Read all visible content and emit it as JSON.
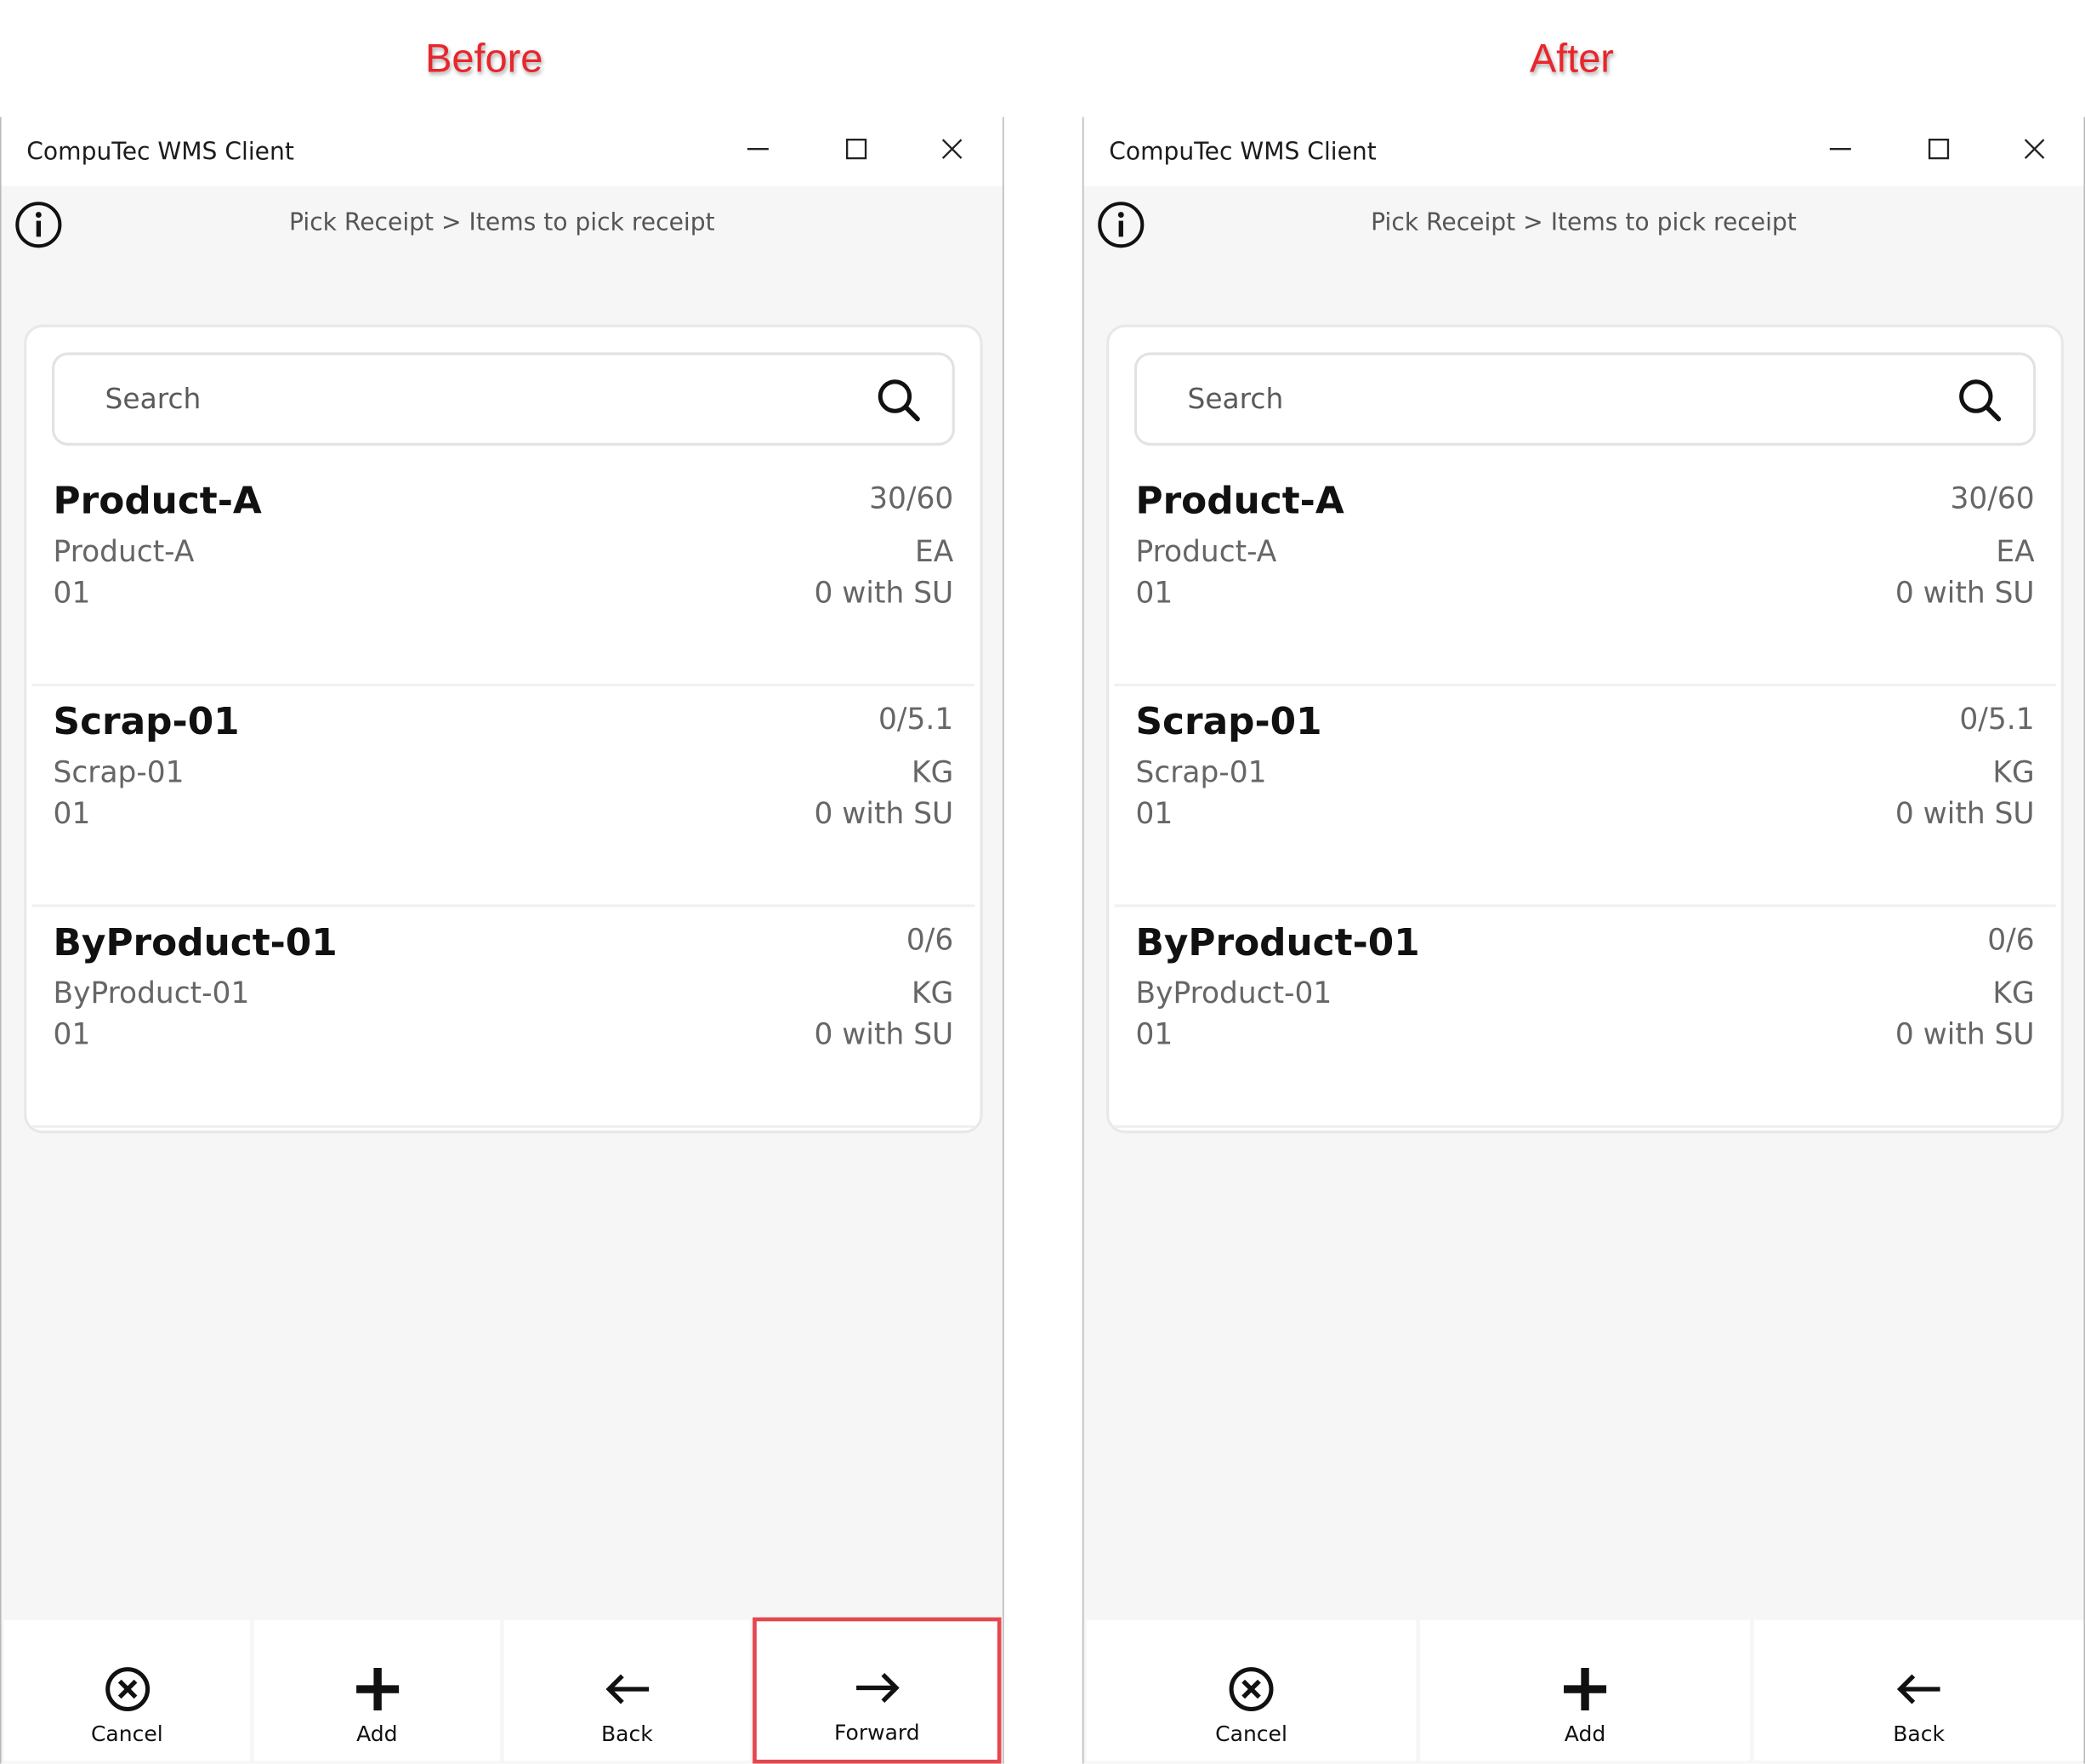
{
  "captions": {
    "before": "Before",
    "after": "After"
  },
  "before": {
    "window_title": "CompuTec WMS Client",
    "breadcrumb": "Pick Receipt > Items to pick receipt",
    "search_placeholder": "Search",
    "items": [
      {
        "name": "Product-A",
        "code": "Product-A",
        "warehouse": "01",
        "qty": "30/60",
        "uom": "EA",
        "su": "0 with SU"
      },
      {
        "name": "Scrap-01",
        "code": "Scrap-01",
        "warehouse": "01",
        "qty": "0/5.1",
        "uom": "KG",
        "su": "0 with SU"
      },
      {
        "name": "ByProduct-01",
        "code": "ByProduct-01",
        "warehouse": "01",
        "qty": "0/6",
        "uom": "KG",
        "su": "0 with SU"
      }
    ],
    "toolbar": {
      "cancel": "Cancel",
      "add": "Add",
      "back": "Back",
      "forward": "Forward"
    }
  },
  "after": {
    "window_title": "CompuTec WMS Client",
    "breadcrumb": "Pick Receipt > Items to pick receipt",
    "search_placeholder": "Search",
    "items": [
      {
        "name": "Product-A",
        "code": "Product-A",
        "warehouse": "01",
        "qty": "30/60",
        "uom": "EA",
        "su": "0 with SU"
      },
      {
        "name": "Scrap-01",
        "code": "Scrap-01",
        "warehouse": "01",
        "qty": "0/5.1",
        "uom": "KG",
        "su": "0 with SU"
      },
      {
        "name": "ByProduct-01",
        "code": "ByProduct-01",
        "warehouse": "01",
        "qty": "0/6",
        "uom": "KG",
        "su": "0 with SU"
      }
    ],
    "toolbar": {
      "cancel": "Cancel",
      "add": "Add",
      "back": "Back"
    }
  },
  "colors": {
    "caption": "#e8262c",
    "highlight": "#e5474f",
    "background": "#f5f6f5"
  },
  "icons": [
    "info-icon",
    "search-icon",
    "minimize-icon",
    "maximize-icon",
    "close-icon",
    "cancel-icon",
    "add-icon",
    "back-arrow-icon",
    "forward-arrow-icon"
  ]
}
